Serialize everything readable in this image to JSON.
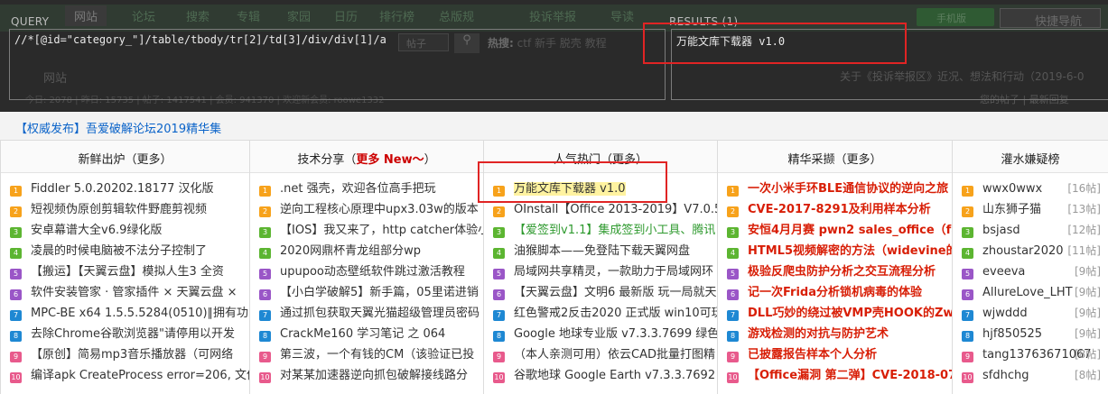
{
  "xpath_helper": {
    "query_label": "QUERY",
    "results_label": "RESULTS (1)",
    "query_value": "//*[@id=\"category_\"]/table/tbody/tr[2]/td[3]/div/div[1]/a",
    "result_value": "万能文库下载器 v1.0"
  },
  "underlying_page": {
    "nav_tabs": [
      "网站",
      "论坛",
      "搜索",
      "专辑",
      "家园",
      "日历",
      "排行榜",
      "总版规",
      "投诉举报",
      "导读"
    ],
    "header_button": "快捷导航",
    "green_button": "手机版",
    "hot_label": "热搜:",
    "hot_words": "ctf 新手 脱壳 教程",
    "search_select": "帖子",
    "site_label": "网站",
    "notice": "关于《投诉举报区》近况、想法和行动（2019-6-0",
    "stats": "今日: 2078 | 昨日: 15735 | 帖子: 1417541 | 会员: 941370 | 欢迎新会员: roowe1332",
    "newest": "您的帖子 | 最新回复"
  },
  "forum": {
    "title": "【权威发布】吾爱破解论坛2019精华集",
    "columns": [
      {
        "head": "新鲜出炉（更多）",
        "items": [
          {
            "badge": "1",
            "color": "o",
            "text": "Fiddler 5.0.20202.18177 汉化版"
          },
          {
            "badge": "2",
            "color": "o",
            "text": "短视频伪原创剪辑软件野鹿剪视频"
          },
          {
            "badge": "3",
            "color": "g",
            "text": "安卓幕谱大全v6.9绿化版"
          },
          {
            "badge": "4",
            "color": "g",
            "text": "凌晨的时候电脑被不法分子控制了"
          },
          {
            "badge": "5",
            "color": "p",
            "text": "【搬运】【天翼云盘】模拟人生3 全资"
          },
          {
            "badge": "6",
            "color": "p",
            "text": "软件安装管家 · 管家插件 × 天翼云盘 ×"
          },
          {
            "badge": "7",
            "color": "b",
            "text": "MPC-BE x64 1.5.5.5284(0510)∥拥有功"
          },
          {
            "badge": "8",
            "color": "b",
            "text": "去除Chrome谷歌浏览器\"请停用以开发"
          },
          {
            "badge": "9",
            "color": "r",
            "text": "【原创】简易mp3音乐播放器（可网络"
          },
          {
            "badge": "10",
            "color": "r",
            "text": "编译apk CreateProcess error=206, 文件"
          }
        ]
      },
      {
        "head_pre": "技术分享（",
        "head_more": "更多 New～",
        "head_post": "）",
        "items": [
          {
            "badge": "1",
            "color": "o",
            "text": ".net 强壳，欢迎各位高手把玩"
          },
          {
            "badge": "2",
            "color": "o",
            "text": "逆向工程核心原理中upx3.03w的版本"
          },
          {
            "badge": "3",
            "color": "g",
            "text": "【IOS】我又来了，http catcher体验小"
          },
          {
            "badge": "4",
            "color": "g",
            "text": "2020网鼎杯青龙组部分wp"
          },
          {
            "badge": "5",
            "color": "p",
            "text": "upupoo动态壁纸软件跳过激活教程"
          },
          {
            "badge": "6",
            "color": "p",
            "text": "【小白学破解5】新手篇，05里诺进销"
          },
          {
            "badge": "7",
            "color": "b",
            "text": "通过抓包获取天翼光猫超级管理员密码"
          },
          {
            "badge": "8",
            "color": "b",
            "text": "CrackMe160 学习笔记 之 064"
          },
          {
            "badge": "9",
            "color": "r",
            "text": "第三波，一个有钱的CM（该验证已投"
          },
          {
            "badge": "10",
            "color": "r",
            "text": "对某某加速器逆向抓包破解接线路分"
          }
        ]
      },
      {
        "head": "人气热门（更多）",
        "items": [
          {
            "badge": "1",
            "color": "o",
            "text": "万能文库下载器 v1.0",
            "style": "hl"
          },
          {
            "badge": "2",
            "color": "o",
            "text": "OInstall【Office 2013-2019】V7.0.5 汉"
          },
          {
            "badge": "3",
            "color": "g",
            "text": "【爱签到v1.1】集成签到小工具、腾讯",
            "style": "green"
          },
          {
            "badge": "4",
            "color": "g",
            "text": "油猴脚本——免登陆下载天翼网盘"
          },
          {
            "badge": "5",
            "color": "p",
            "text": "局域网共享精灵，一款助力于局域网环"
          },
          {
            "badge": "6",
            "color": "p",
            "text": "【天翼云盘】文明6 最新版 玩一局就天"
          },
          {
            "badge": "7",
            "color": "b",
            "text": "红色警戒2反击2020 正式版 win10可玩"
          },
          {
            "badge": "8",
            "color": "b",
            "text": "Google 地球专业版 v7.3.3.7699 绿色便"
          },
          {
            "badge": "9",
            "color": "r",
            "text": "（本人亲测可用）依云CAD批量打图精"
          },
          {
            "badge": "10",
            "color": "r",
            "text": "谷歌地球 Google Earth v7.3.3.7692 专"
          }
        ]
      },
      {
        "head": "精华采撷（更多）",
        "items": [
          {
            "badge": "1",
            "color": "o",
            "text": "一次小米手环BLE通信协议的逆向之旅",
            "style": "red"
          },
          {
            "badge": "2",
            "color": "o",
            "text": "CVE-2017-8291及利用样本分析",
            "style": "red"
          },
          {
            "badge": "3",
            "color": "g",
            "text": "安恒4月月赛 pwn2 sales_office（fast",
            "style": "red"
          },
          {
            "badge": "4",
            "color": "g",
            "text": "HTML5视频解密的方法（widevine的",
            "style": "red"
          },
          {
            "badge": "5",
            "color": "p",
            "text": "极验反爬虫防护分析之交互流程分析",
            "style": "red"
          },
          {
            "badge": "6",
            "color": "p",
            "text": "记一次Frida分析锁机病毒的体验",
            "style": "red"
          },
          {
            "badge": "7",
            "color": "b",
            "text": "DLL巧妙的绕过被VMP壳HOOK的ZwP",
            "style": "red"
          },
          {
            "badge": "8",
            "color": "b",
            "text": "游戏检测的对抗与防护艺术",
            "style": "red"
          },
          {
            "badge": "9",
            "color": "r",
            "text": "已披露报告样本个人分析",
            "style": "red"
          },
          {
            "badge": "10",
            "color": "r",
            "text": "【Office漏洞 第二弹】CVE-2018-079",
            "style": "red"
          }
        ]
      },
      {
        "head": "灌水嫌疑榜",
        "items": [
          {
            "badge": "1",
            "color": "o",
            "text": "wwx0wwx",
            "count": "[16帖]"
          },
          {
            "badge": "2",
            "color": "o",
            "text": "山东狮子猫",
            "count": "[13帖]"
          },
          {
            "badge": "3",
            "color": "g",
            "text": "bsjasd",
            "count": "[12帖]"
          },
          {
            "badge": "4",
            "color": "g",
            "text": "zhoustar2020",
            "count": "[11帖]"
          },
          {
            "badge": "5",
            "color": "p",
            "text": "eveeva",
            "count": "[9帖]"
          },
          {
            "badge": "6",
            "color": "p",
            "text": "AllureLove_LHT",
            "count": "[9帖]"
          },
          {
            "badge": "7",
            "color": "b",
            "text": "wjwddd",
            "count": "[9帖]"
          },
          {
            "badge": "8",
            "color": "b",
            "text": "hjf850525",
            "count": "[9帖]"
          },
          {
            "badge": "9",
            "color": "r",
            "text": "tang13763671067",
            "count": "[8帖]"
          },
          {
            "badge": "10",
            "color": "r",
            "text": "sfdhchg",
            "count": "[8帖]"
          }
        ]
      }
    ]
  },
  "colors": {
    "overlay_bg": "#2b2b2b",
    "highlight_border": "#e02424",
    "link_blue": "#0a63c9",
    "essence_red": "#d81e06"
  }
}
